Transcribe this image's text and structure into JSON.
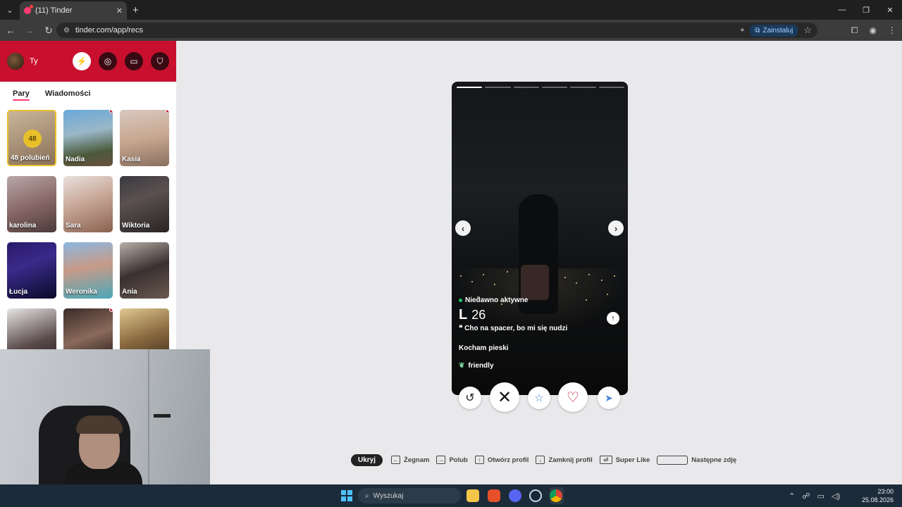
{
  "browser": {
    "tab_title": "(11) Tinder",
    "tab_close": "✕",
    "new_tab": "+",
    "url": "tinder.com/app/recs",
    "install_label": "Zainstaluj",
    "window_controls": [
      "—",
      "❐",
      "✕"
    ]
  },
  "sidebar": {
    "user_name": "Ty",
    "header_buttons": [
      {
        "icon": "lightning-icon",
        "glyph": "⚡"
      },
      {
        "icon": "compass-icon",
        "glyph": "◎"
      },
      {
        "icon": "briefcase-icon",
        "glyph": "▭"
      },
      {
        "icon": "shield-icon",
        "glyph": "⛉"
      }
    ],
    "tabs": {
      "matches": "Pary",
      "messages": "Wiadomości"
    },
    "likes_card": {
      "count": "48",
      "label": "48 polubień"
    },
    "matches": [
      {
        "name": "Nadia",
        "unread": true
      },
      {
        "name": "Kasia",
        "unread": true
      },
      {
        "name": "karolina",
        "unread": false
      },
      {
        "name": "Sara",
        "unread": false
      },
      {
        "name": "Wiktoria",
        "unread": false
      },
      {
        "name": "Łucja",
        "unread": false
      },
      {
        "name": "Weronika",
        "unread": false
      },
      {
        "name": "Ania",
        "unread": false
      },
      {
        "name": "",
        "unread": false
      },
      {
        "name": "",
        "unread": true
      },
      {
        "name": "",
        "unread": false
      }
    ]
  },
  "profile": {
    "photo_count": 6,
    "current_photo": 1,
    "status": "Niedawno aktywne",
    "name": "L",
    "age": "26",
    "quote": "❝ Cho na spacer, bo mi się nudzi",
    "bio": "Kocham pieski",
    "tag": "friendly"
  },
  "actions": {
    "rewind": "↺",
    "nope": "✕",
    "super_like": "☆",
    "like": "♡",
    "boost": "➤"
  },
  "shortcuts": {
    "hide": "Ukryj",
    "items": [
      {
        "key": "←",
        "label": "Żegnam"
      },
      {
        "key": "→",
        "label": "Polub"
      },
      {
        "key": "↑",
        "label": "Otwórz profil"
      },
      {
        "key": "↓",
        "label": "Zamknij profil"
      },
      {
        "key": "⏎",
        "label": "Super Like"
      }
    ],
    "space_label": "Następne zdjęcie"
  },
  "taskbar": {
    "search_placeholder": "Wyszukaj",
    "time": "23:00",
    "date": "25.08.2026"
  },
  "colors": {
    "brand_red": "#c8102e",
    "tinder_pink": "#fe3c72",
    "likes_gold": "#e8c02a",
    "online_green": "#1ec66a"
  }
}
